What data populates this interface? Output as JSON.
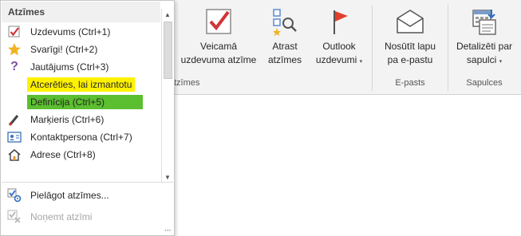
{
  "dropdown": {
    "title": "Atzīmes",
    "items": [
      {
        "label": "Uzdevums (Ctrl+1)",
        "icon": "checkbox-check-icon"
      },
      {
        "label": "Svarīgi! (Ctrl+2)",
        "icon": "star-icon"
      },
      {
        "label": "Jautājums (Ctrl+3)",
        "icon": "question-icon"
      },
      {
        "label": "Atcerēties, lai izmantotu",
        "icon": "none",
        "highlight": "#fff200"
      },
      {
        "label": "Definīcija (Ctrl+5)",
        "icon": "none",
        "highlight": "#5bbf2f"
      },
      {
        "label": "Marķieris (Ctrl+6)",
        "icon": "highlighter-icon"
      },
      {
        "label": "Kontaktpersona (Ctrl+7)",
        "icon": "contact-card-icon"
      },
      {
        "label": "Adrese (Ctrl+8)",
        "icon": "home-icon"
      }
    ],
    "customize_label": "Pielāgot atzīmes...",
    "remove_label": "Noņemt atzīmi"
  },
  "ribbon": {
    "groups": [
      {
        "name": "Atzīmes",
        "label_visible": "tzīmes"
      },
      {
        "name": "E-pasts",
        "label_visible": "E-pasts"
      },
      {
        "name": "Sapulces",
        "label_visible": "Sapulces"
      }
    ],
    "buttons": [
      {
        "line1": "Veicamā",
        "line2": "uzdevuma atzīme",
        "icon": "todo-check-icon"
      },
      {
        "line1": "Atrast",
        "line2": "atzīmes",
        "icon": "find-tags-icon"
      },
      {
        "line1": "Outlook",
        "line2": "uzdevumi",
        "icon": "outlook-flag-icon",
        "dropdown": true
      },
      {
        "line1": "Nosūtīt lapu",
        "line2": "pa e-pastu",
        "icon": "email-envelope-icon"
      },
      {
        "line1": "Detalizēti par",
        "line2": "sapulci",
        "icon": "meeting-details-icon",
        "dropdown": true
      }
    ]
  },
  "colors": {
    "check_red": "#d13438",
    "star_gold": "#f0b323",
    "question_purple": "#7b4fa6",
    "flag_red": "#e0402e"
  }
}
